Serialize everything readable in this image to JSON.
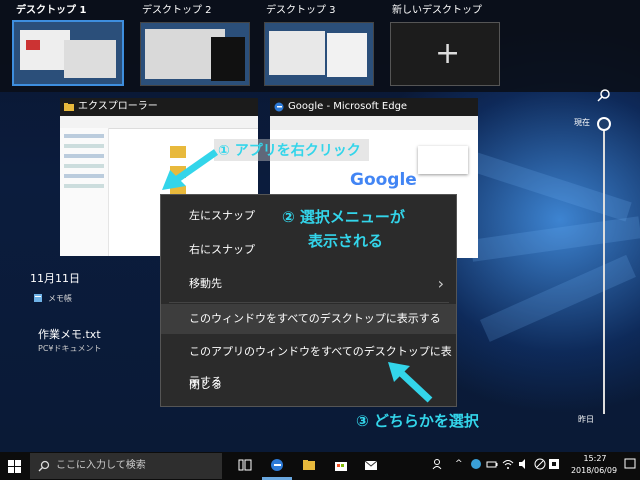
{
  "desktops": [
    {
      "label": "デスクトップ 1"
    },
    {
      "label": "デスクトップ 2"
    },
    {
      "label": "デスクトップ 3"
    },
    {
      "label": "新しいデスクトップ",
      "symbol": "+"
    }
  ],
  "windows": {
    "explorer": {
      "title": "エクスプローラー",
      "icon": "folder-icon"
    },
    "edge": {
      "title": "Google - Microsoft Edge",
      "icon": "edge-icon",
      "logo": "Google"
    }
  },
  "context_menu": {
    "items": [
      {
        "label": "左にスナップ"
      },
      {
        "label": "右にスナップ"
      },
      {
        "label": "移動先",
        "submenu": true
      },
      {
        "label": "このウィンドウをすべてのデスクトップに表示する"
      },
      {
        "label": "このアプリのウィンドウをすべてのデスクトップに表示する"
      },
      {
        "label": "閉じる"
      }
    ],
    "highlighted_index": 3
  },
  "annotations": {
    "step1": "① アプリを右クリック",
    "step2_line1": "② 選択メニューが",
    "step2_line2": "表示される",
    "step3": "③ どちらかを選択",
    "color": "#33d5ea"
  },
  "timeline": {
    "date": "11月11日",
    "app_name": "メモ帳",
    "file_name": "作業メモ.txt",
    "file_path": "PC¥ドキュメント",
    "now_label": "現在",
    "yesterday_label": "昨日"
  },
  "taskbar": {
    "search_placeholder": "ここに入力して検索",
    "time": "15:27",
    "date": "2018/06/09",
    "pinned_icons": [
      "task-view-icon",
      "edge-icon",
      "file-explorer-icon",
      "store-icon",
      "mail-icon"
    ]
  }
}
